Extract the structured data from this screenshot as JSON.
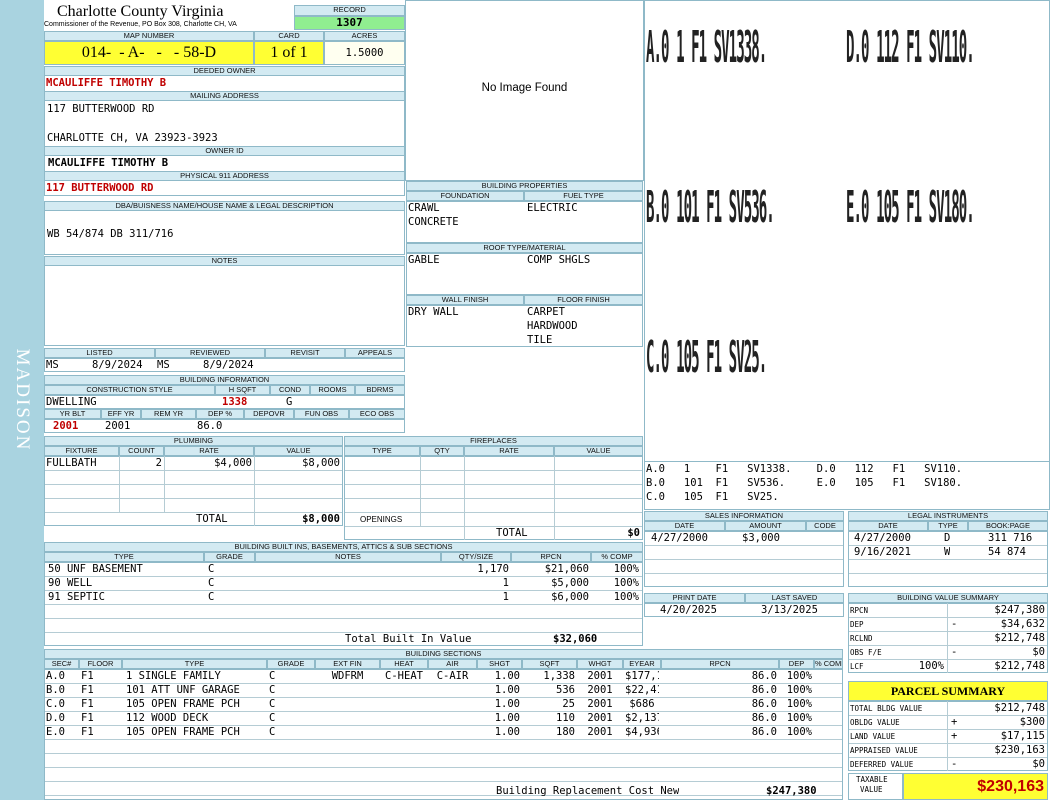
{
  "sidebar": {
    "district": "MADISON"
  },
  "header": {
    "county": "Charlotte County Virginia",
    "commissioner": "Commissioner of the Revenue, PO Box 308, Charlotte CH, VA",
    "record_label": "RECORD",
    "record": "1307"
  },
  "parcel": {
    "map_label": "MAP NUMBER",
    "map_number": "014-  - A-   -   - 58-D",
    "card_label": "CARD",
    "card": "1 of 1",
    "acres_label": "ACRES",
    "acres": "1.5000"
  },
  "owner": {
    "deeded_label": "DEEDED OWNER",
    "deeded": "MCAULIFFE TIMOTHY B",
    "mailing_label": "MAILING ADDRESS",
    "mail1": "117 BUTTERWOOD RD",
    "mail2": "CHARLOTTE CH, VA 23923-3923",
    "ownerid_label": "OWNER ID",
    "ownerid": "MCAULIFFE TIMOTHY B",
    "phys_label": "PHYSICAL 911 ADDRESS",
    "phys": "117 BUTTERWOOD RD"
  },
  "legal": {
    "label": "DBA/BUISNESS NAME/HOUSE NAME & LEGAL DESCRIPTION",
    "text": "WB 54/874 DB 311/716"
  },
  "notes": {
    "label": "NOTES"
  },
  "image": {
    "text": "No Image Found"
  },
  "listing": {
    "listed_label": "LISTED",
    "listed_by": "MS",
    "listed_date": "8/9/2024",
    "reviewed_label": "REVIEWED",
    "reviewed_by": "MS",
    "reviewed_date": "8/9/2024",
    "revisit_label": "REVISIT",
    "appeals_label": "APPEALS"
  },
  "building_info": {
    "label": "BUILDING INFORMATION",
    "style_label": "CONSTRUCTION STYLE",
    "hsqft_label": "H SQFT",
    "cond_label": "COND",
    "rooms_label": "ROOMS",
    "bdrms_label": "BDRMS",
    "style": "DWELLING",
    "hsqft": "1338",
    "cond": "G",
    "yrblt_label": "YR BLT",
    "effyr_label": "EFF YR",
    "remyr_label": "REM YR",
    "dep_label": "DEP %",
    "depovr_label": "DEPOVR",
    "funobs_label": "FUN OBS",
    "ecoobs_label": "ECO OBS",
    "yrblt": "2001",
    "effyr": "2001",
    "dep": "86.0"
  },
  "building_props": {
    "label": "BUILDING PROPERTIES",
    "foundation_label": "FOUNDATION",
    "fuel_label": "FUEL TYPE",
    "foundation1": "CRAWL",
    "foundation2": "CONCRETE",
    "fuel": "ELECTRIC",
    "roof_label": "ROOF TYPE/MATERIAL",
    "roof_type": "GABLE",
    "roof_mat": "COMP SHGLS",
    "wall_label": "WALL FINISH",
    "floor_label": "FLOOR FINISH",
    "wall": "DRY WALL",
    "floor1": "CARPET",
    "floor2": "HARDWOOD",
    "floor3": "TILE"
  },
  "sketch": {
    "big": [
      "A.0  1  F1  SV1338.",
      "D.0  112  F1  SV110.",
      "B.0  101  F1  SV536.",
      "E.0  105  F1  SV180.",
      "C.0  105  F1  SV25."
    ],
    "small1": "A.0   1    F1   SV1338.    D.0   112   F1   SV110.",
    "small2": "B.0   101  F1   SV536.     E.0   105   F1   SV180.",
    "small3": "C.0   105  F1   SV25."
  },
  "plumbing": {
    "label": "PLUMBING",
    "h_fixture": "FIXTURE",
    "h_count": "COUNT",
    "h_rate": "RATE",
    "h_value": "VALUE",
    "fixture": "FULLBATH",
    "count": "2",
    "rate": "$4,000",
    "value": "$8,000",
    "total_label": "TOTAL",
    "total": "$8,000"
  },
  "fireplaces": {
    "label": "FIREPLACES",
    "h_type": "TYPE",
    "h_qty": "QTY",
    "h_rate": "RATE",
    "h_value": "VALUE",
    "openings": "OPENINGS",
    "total_label": "TOTAL",
    "total": "$0"
  },
  "sales": {
    "label": "SALES INFORMATION",
    "h_date": "DATE",
    "h_amount": "AMOUNT",
    "h_code": "CODE",
    "date": "4/27/2000",
    "amount": "$3,000"
  },
  "legal_inst": {
    "label": "LEGAL INSTRUMENTS",
    "h_date": "DATE",
    "h_type": "TYPE",
    "h_book": "BOOK:PAGE",
    "rows": [
      {
        "date": "4/27/2000",
        "type": "D",
        "book": "311 716"
      },
      {
        "date": "9/16/2021",
        "type": "W",
        "book": "54 874"
      }
    ]
  },
  "dates": {
    "print_label": "PRINT DATE",
    "saved_label": "LAST SAVED",
    "print": "4/20/2025",
    "saved": "3/13/2025"
  },
  "builtins": {
    "label": "BUILDING BUILT INS, BASEMENTS, ATTICS & SUB SECTIONS",
    "h_type": "TYPE",
    "h_grade": "GRADE",
    "h_notes": "NOTES",
    "h_qty": "QTY/SIZE",
    "h_rpcn": "RPCN",
    "h_comp": "% COMP",
    "rows": [
      {
        "type": "50 UNF BASEMENT",
        "grade": "C",
        "qty": "1,170",
        "rpcn": "$21,060",
        "comp": "100%"
      },
      {
        "type": "90 WELL",
        "grade": "C",
        "qty": "1",
        "rpcn": "$5,000",
        "comp": "100%"
      },
      {
        "type": "91 SEPTIC",
        "grade": "C",
        "qty": "1",
        "rpcn": "$6,000",
        "comp": "100%"
      }
    ],
    "total_label": "Total Built In Value",
    "total": "$32,060"
  },
  "sections": {
    "label": "BUILDING SECTIONS",
    "h": [
      "SEC#",
      "FLOOR",
      "TYPE",
      "GRADE",
      "EXT FIN",
      "HEAT",
      "AIR",
      "SHGT",
      "SQFT",
      "WHGT",
      "EYEAR",
      "RPCN",
      "DEP",
      "% COMP"
    ],
    "rows": [
      [
        "A.0",
        "F1",
        "1 SINGLE FAMILY",
        "C",
        "WDFRM",
        "C-HEAT",
        "C-AIR",
        "1.00",
        "1,338",
        "2001",
        "$177,145",
        "86.0",
        "100%"
      ],
      [
        "B.0",
        "F1",
        "101 ATT UNF GARAGE",
        "C",
        "",
        "",
        "",
        "1.00",
        "536",
        "2001",
        "$22,416",
        "86.0",
        "100%"
      ],
      [
        "C.0",
        "F1",
        "105 OPEN FRAME PCH",
        "C",
        "",
        "",
        "",
        "1.00",
        "25",
        "2001",
        "$686",
        "86.0",
        "100%"
      ],
      [
        "D.0",
        "F1",
        "112 WOOD DECK",
        "C",
        "",
        "",
        "",
        "1.00",
        "110",
        "2001",
        "$2,137",
        "86.0",
        "100%"
      ],
      [
        "E.0",
        "F1",
        "105 OPEN FRAME PCH",
        "C",
        "",
        "",
        "",
        "1.00",
        "180",
        "2001",
        "$4,936",
        "86.0",
        "100%"
      ]
    ],
    "brcn_label": "Building Replacement Cost New",
    "brcn": "$247,380"
  },
  "value_summary": {
    "label": "BUILDING VALUE SUMMARY",
    "rows": [
      {
        "k": "RPCN",
        "op": "",
        "v": "$247,380"
      },
      {
        "k": "DEP",
        "op": "-",
        "v": "$34,632"
      },
      {
        "k": "RCLND",
        "op": "",
        "v": "$212,748"
      },
      {
        "k": "OBS F/E",
        "op": "-",
        "v": "$0"
      },
      {
        "k": "LCF",
        "pct": "100%",
        "op": "",
        "v": "$212,748"
      }
    ]
  },
  "parcel_summary": {
    "label": "PARCEL SUMMARY",
    "rows": [
      {
        "k": "TOTAL BLDG VALUE",
        "op": "",
        "v": "$212,748"
      },
      {
        "k": "OBLDG VALUE",
        "op": "+",
        "v": "$300"
      },
      {
        "k": "LAND VALUE",
        "op": "+",
        "v": "$17,115"
      },
      {
        "k": "APPRAISED VALUE",
        "op": "",
        "v": "$230,163"
      },
      {
        "k": "DEFERRED VALUE",
        "op": "-",
        "v": "$0"
      }
    ],
    "taxable_label1": "TAXABLE",
    "taxable_label2": "VALUE",
    "taxable": "$230,163"
  }
}
